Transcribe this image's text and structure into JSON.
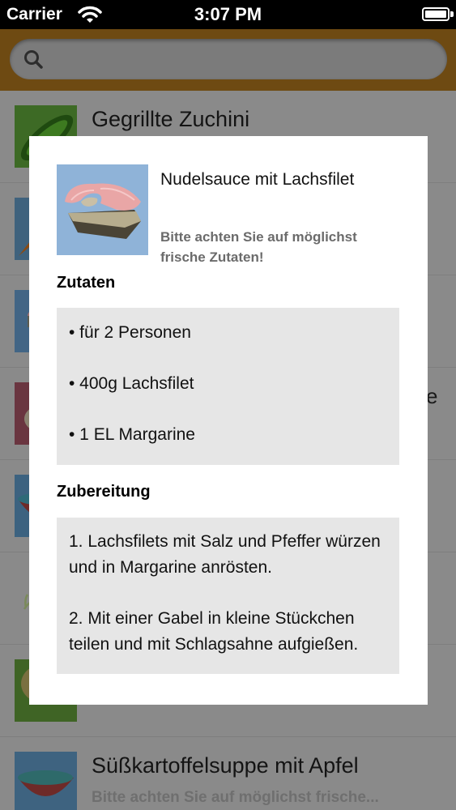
{
  "status_bar": {
    "carrier": "Carrier",
    "time": "3:07 PM"
  },
  "search": {
    "placeholder": ""
  },
  "list": {
    "items": [
      {
        "title": "Gegrillte Zuchini",
        "subtitle": "",
        "icon": "zucchini-image"
      },
      {
        "title": "",
        "subtitle": "",
        "icon": "carrot-image"
      },
      {
        "title": "",
        "subtitle": "",
        "icon": "salmon-image"
      },
      {
        "title": "",
        "subtitle": "",
        "icon": "meat-image"
      },
      {
        "title": "",
        "subtitle": "",
        "icon": "soup-bowl-image"
      },
      {
        "title": "",
        "subtitle": "",
        "icon": "herb-image"
      },
      {
        "title": "",
        "subtitle": "",
        "icon": "potato-image"
      },
      {
        "title": "Süßkartoffelsuppe mit Apfel",
        "subtitle": "Bitte achten Sie auf möglichst frische...",
        "icon": "soup-bowl-image"
      }
    ],
    "ghost_letter": "e"
  },
  "modal": {
    "title": "Nudelsauce mit Lachsfilet",
    "note": "Bitte achten Sie auf möglichst frische Zutaten!",
    "ingredients_heading": "Zutaten",
    "ingredients": [
      "• für 2 Personen",
      "• 400g Lachsfilet",
      "• 1 EL Margarine"
    ],
    "preparation_heading": "Zubereitung",
    "steps": [
      "1. Lachsfilets mit Salz und Pfeffer würzen und in Margarine anrösten.",
      "2. Mit einer Gabel in kleine Stückchen teilen und mit Schlagsahne aufgießen."
    ]
  },
  "colors": {
    "overlay_gray": "#8a8a8a",
    "search_bar_brown": "#6e4a12",
    "modal_background": "#ffffff",
    "box_background": "#e6e6e6"
  }
}
